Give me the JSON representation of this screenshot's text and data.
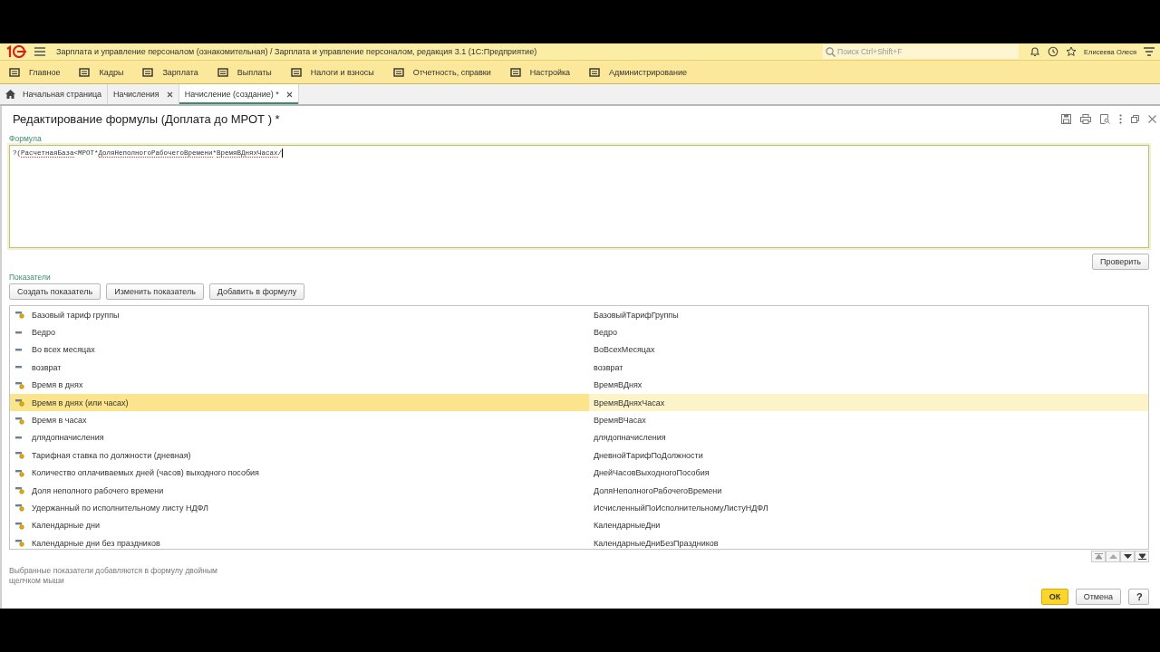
{
  "app_bar": {
    "title": "Зарплата и управление персоналом (ознакомительная) / Зарплата и управление персоналом, редакция 3.1  (1С:Предприятие)",
    "search": {
      "placeholder": "Поиск Ctrl+Shift+F"
    },
    "user": "Елисеева Олеся"
  },
  "sections": [
    "Главное",
    "Кадры",
    "Зарплата",
    "Выплаты",
    "Налоги и взносы",
    "Отчетность, справки",
    "Настройка",
    "Администрирование"
  ],
  "tabs": [
    {
      "label": "Начальная страница",
      "selected": false,
      "closable": false
    },
    {
      "label": "Начисления",
      "selected": false,
      "closable": true
    },
    {
      "label": "Начисление (создание) *",
      "selected": true,
      "closable": true
    }
  ],
  "form": {
    "title": "Редактирование формулы (Доплата до МРОТ ) *",
    "formula_label": "Формула",
    "formula": [
      {
        "text": "?(",
        "underlined": false
      },
      {
        "text": "РасчетнаяБаза",
        "underlined": true
      },
      {
        "text": "<МРОТ*",
        "underlined": false
      },
      {
        "text": "ДоляНеполногоРабочегоВремени",
        "underlined": true
      },
      {
        "text": "*",
        "underlined": false
      },
      {
        "text": "ВремяВДняхЧасах",
        "underlined": true
      },
      {
        "text": "/",
        "underlined": false
      }
    ],
    "check_button": "Проверить",
    "indicators_label": "Показатели",
    "buttons": [
      "Создать показатель",
      "Изменить показатель",
      "Добавить в формулу"
    ],
    "rows": [
      {
        "kind": "param",
        "name": "Базовый тариф группы",
        "id": "БазовыйТарифГруппы",
        "selected": false
      },
      {
        "kind": "plain",
        "name": "Ведро",
        "id": "Ведро",
        "selected": false
      },
      {
        "kind": "plain",
        "name": "Во всех месяцах",
        "id": "ВоВсехМесяцах",
        "selected": false
      },
      {
        "kind": "plain",
        "name": "возврат",
        "id": "возврат",
        "selected": false
      },
      {
        "kind": "param",
        "name": "Время в днях",
        "id": "ВремяВДнях",
        "selected": false
      },
      {
        "kind": "param",
        "name": "Время в днях (или часах)",
        "id": "ВремяВДняхЧасах",
        "selected": true
      },
      {
        "kind": "param",
        "name": "Время в часах",
        "id": "ВремяВЧасах",
        "selected": false
      },
      {
        "kind": "plain",
        "name": "длядопначисления",
        "id": "длядопначисления",
        "selected": false
      },
      {
        "kind": "param",
        "name": "Тарифная ставка по должности (дневная)",
        "id": "ДневнойТарифПоДолжности",
        "selected": false
      },
      {
        "kind": "param",
        "name": "Количество оплачиваемых дней (часов) выходного пособия",
        "id": "ДнейЧасовВыходногоПособия",
        "selected": false
      },
      {
        "kind": "param",
        "name": "Доля неполного рабочего времени",
        "id": "ДоляНеполногоРабочегоВремени",
        "selected": false
      },
      {
        "kind": "param",
        "name": "Удержанный по исполнительному листу НДФЛ",
        "id": "ИсчисленныйПоИсполнительномуЛистуНДФЛ",
        "selected": false
      },
      {
        "kind": "param",
        "name": "Календарные дни",
        "id": "КалендарныеДни",
        "selected": false
      },
      {
        "kind": "param",
        "name": "Календарные дни без праздников",
        "id": "КалендарныеДниБезПраздников",
        "selected": false
      }
    ],
    "hint": "Выбранные показатели добавляются в формулу двойным щелчком мыши",
    "ok": "ОК",
    "cancel": "Отмена",
    "help": "?"
  }
}
